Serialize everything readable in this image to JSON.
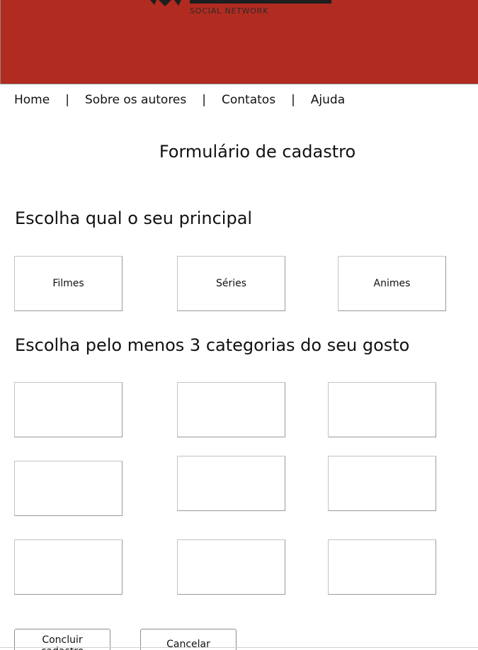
{
  "header": {
    "tagline": "SOCIAL NETWORK",
    "banner_color": "#b22b20"
  },
  "nav": {
    "items": [
      "Home",
      "Sobre os autores",
      "Contatos",
      "Ajuda"
    ],
    "separator": "|"
  },
  "form": {
    "title": "Formulário de cadastro",
    "main_section": {
      "heading": "Escolha qual o seu principal",
      "options": [
        "Filmes",
        "Séries",
        "Animes"
      ]
    },
    "categories_section": {
      "heading": "Escolha pelo menos 3 categorias do seu gosto",
      "options": [
        "",
        "",
        "",
        "",
        "",
        "",
        "",
        "",
        ""
      ]
    },
    "buttons": {
      "submit": "Concluir cadastro",
      "cancel": "Cancelar"
    }
  }
}
